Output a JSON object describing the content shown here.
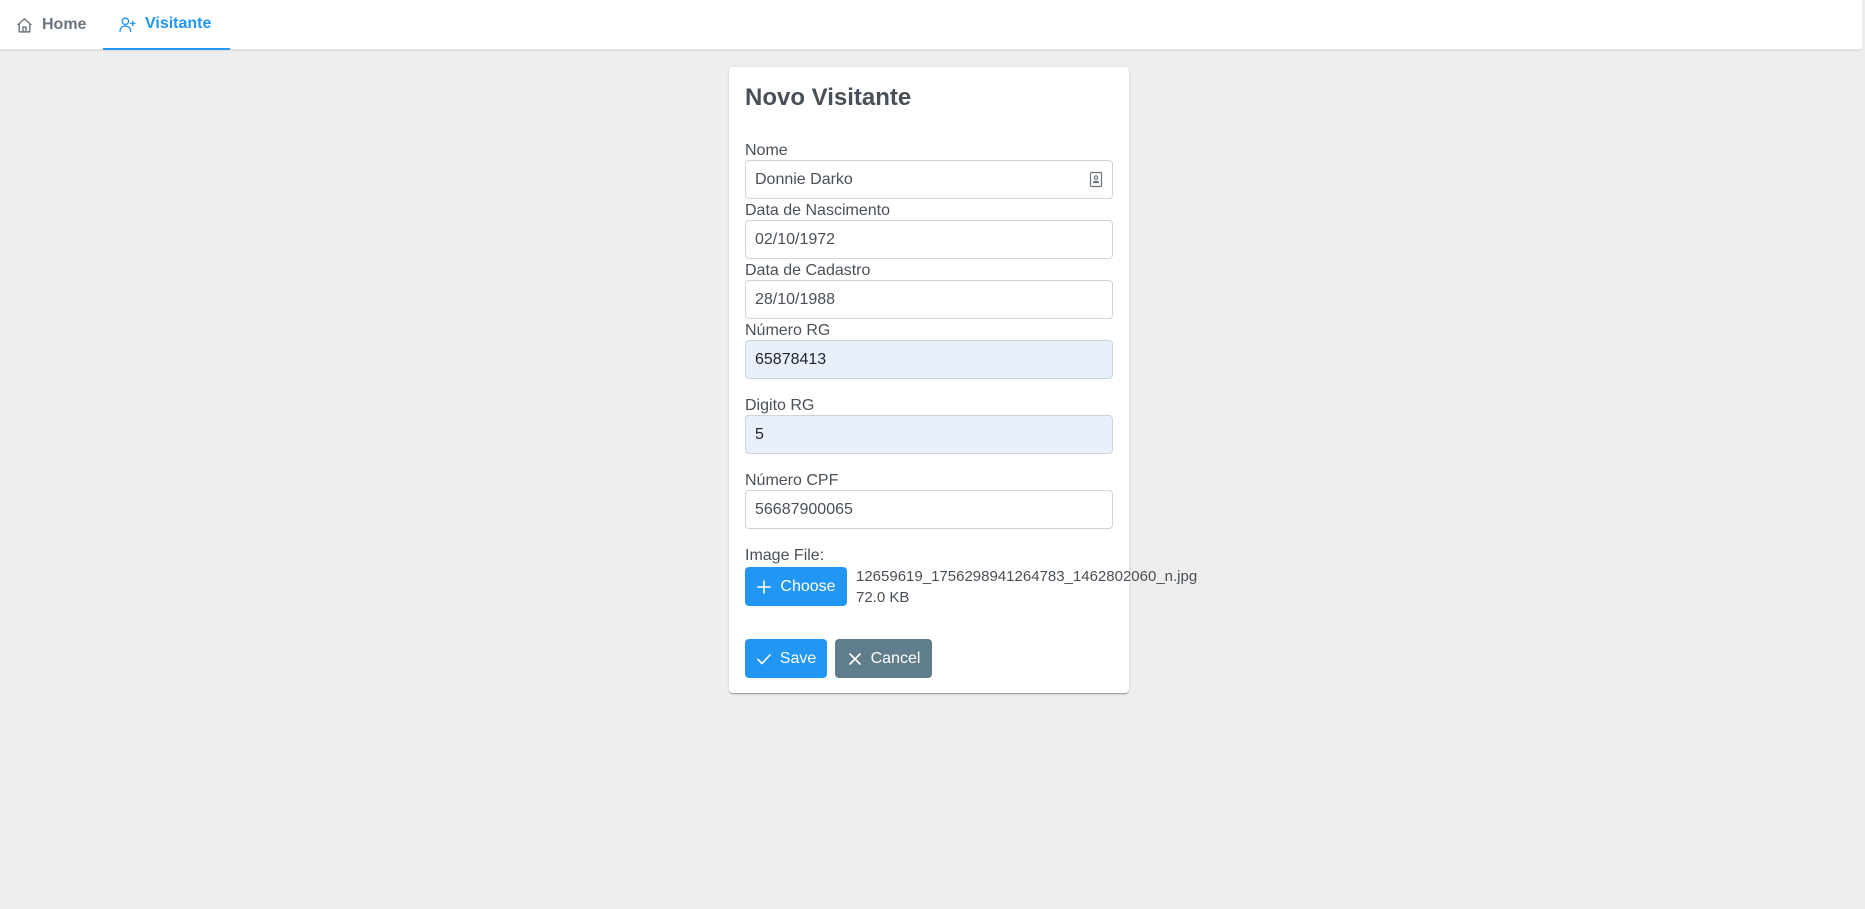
{
  "nav": {
    "tabs": [
      {
        "label": "Home",
        "icon": "home-icon",
        "active": false
      },
      {
        "label": "Visitante",
        "icon": "user-plus-icon",
        "active": true
      }
    ]
  },
  "form": {
    "title": "Novo Visitante",
    "fields": {
      "nome": {
        "label": "Nome",
        "value": "Donnie Darko"
      },
      "data_nascimento": {
        "label": "Data de Nascimento",
        "value": "02/10/1972"
      },
      "data_cadastro": {
        "label": "Data de Cadastro",
        "value": "28/10/1988"
      },
      "numero_rg": {
        "label": "Número RG",
        "value": "65878413"
      },
      "digito_rg": {
        "label": "Digito RG",
        "value": "5"
      },
      "numero_cpf": {
        "label": "Número CPF",
        "value": "56687900065"
      }
    },
    "image_file": {
      "label": "Image File:",
      "choose_label": "Choose",
      "file_name": "12659619_1756298941264783_1462802060_n.jpg",
      "file_size": "72.0 KB"
    },
    "actions": {
      "save_label": "Save",
      "cancel_label": "Cancel"
    }
  },
  "colors": {
    "primary": "#2196f3",
    "secondary": "#607d8b",
    "autofill_background": "#e8f0fe",
    "page_background": "#eeeeee"
  }
}
